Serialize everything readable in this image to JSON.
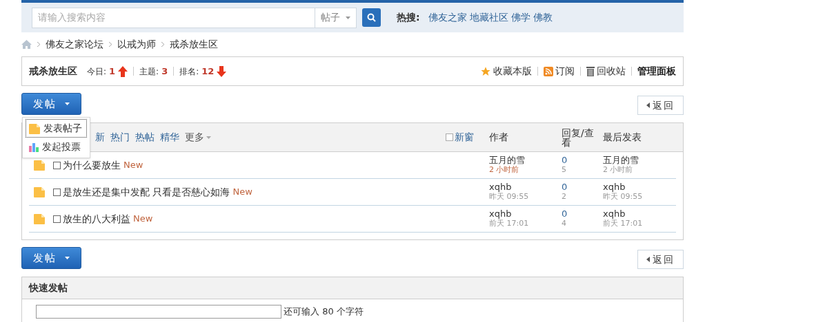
{
  "search": {
    "placeholder": "请输入搜索内容",
    "scope": "帖子",
    "hot_label": "热搜:",
    "hot_links": [
      "佛友之家",
      "地藏社区",
      "佛学",
      "佛教"
    ]
  },
  "breadcrumb": [
    "佛友之家论坛",
    "以戒为师",
    "戒杀放生区"
  ],
  "forum": {
    "name": "戒杀放生区",
    "today_label": "今日:",
    "today": "1",
    "topics_label": "主题:",
    "topics": "3",
    "rank_label": "排名:",
    "rank": "12",
    "actions": [
      {
        "kind": "star",
        "label": "收藏本版"
      },
      {
        "kind": "rss",
        "label": "订阅"
      },
      {
        "kind": "trash",
        "label": "回收站"
      },
      {
        "kind": "admin",
        "label": "管理面板"
      }
    ]
  },
  "post_buttons": [
    "发帖",
    "发帖"
  ],
  "back_buttons": [
    "返回",
    "返回"
  ],
  "post_menu": [
    {
      "kind": "thread",
      "label": "发表帖子",
      "selected": true
    },
    {
      "kind": "poll",
      "label": "发起投票",
      "selected": false
    }
  ],
  "filters": [
    {
      "label": "新",
      "more": false
    },
    {
      "label": "热门",
      "more": false
    },
    {
      "label": "热帖",
      "more": false
    },
    {
      "label": "精华",
      "more": false
    },
    {
      "label": "更多",
      "more": true
    }
  ],
  "new_window": {
    "label": "新窗",
    "checked": false
  },
  "columns": {
    "author": "作者",
    "replies": "回复/查看",
    "last": "最后发表"
  },
  "threads": [
    {
      "title": "为什么要放生",
      "badge": "New",
      "checked": false,
      "author": "五月的雪",
      "time": "2 小时前",
      "recent": true,
      "replies": "0",
      "views": "5",
      "last_author": "五月的雪",
      "last_time": "2 小时前"
    },
    {
      "title": "是放生还是集中发配 只看是否慈心如海",
      "badge": "New",
      "checked": false,
      "author": "xqhb",
      "time": "昨天 09:55",
      "recent": false,
      "replies": "0",
      "views": "2",
      "last_author": "xqhb",
      "last_time": "昨天 09:55"
    },
    {
      "title": "放生的八大利益",
      "badge": "New",
      "checked": false,
      "author": "xqhb",
      "time": "前天 17:01",
      "recent": false,
      "replies": "0",
      "views": "4",
      "last_author": "xqhb",
      "last_time": "前天 17:01"
    }
  ],
  "quick_post": {
    "title": "快速发帖",
    "hint": "还可输入 80 个字符"
  }
}
